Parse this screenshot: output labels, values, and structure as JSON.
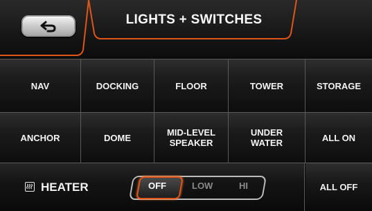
{
  "header": {
    "title": "LIGHTS + SWITCHES",
    "back_icon": "back-arrow-icon"
  },
  "grid": {
    "row1": [
      "NAV",
      "DOCKING",
      "FLOOR",
      "TOWER",
      "STORAGE"
    ],
    "row2": [
      [
        "ANCHOR"
      ],
      [
        "DOME"
      ],
      [
        "MID-LEVEL",
        "SPEAKER"
      ],
      [
        "UNDER",
        "WATER"
      ],
      [
        "ALL ON"
      ]
    ]
  },
  "heater": {
    "icon": "heater-icon",
    "label": "HEATER",
    "options": [
      "OFF",
      "LOW",
      "HI"
    ],
    "selected": "OFF"
  },
  "all_off": "ALL OFF",
  "colors": {
    "accent": "#e0561a",
    "inactive_text": "#8a8a8a"
  }
}
